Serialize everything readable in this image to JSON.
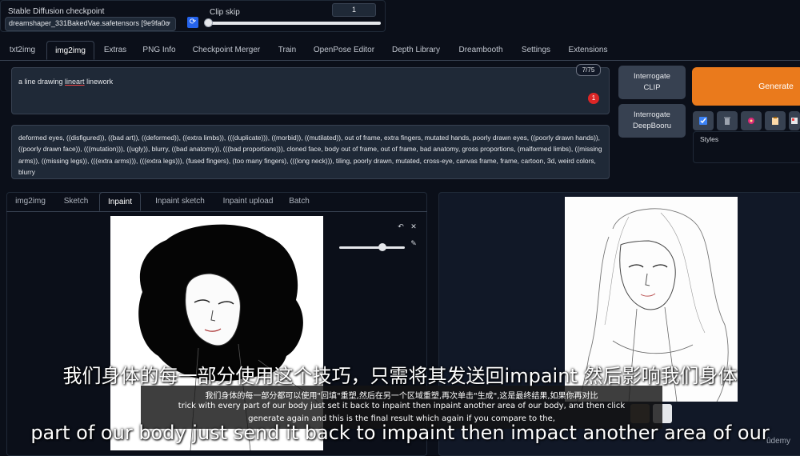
{
  "checkpoint": {
    "label": "Stable Diffusion checkpoint",
    "value": "dreamshaper_331BakedVae.safetensors [9e9fa0c"
  },
  "clip_skip": {
    "label": "Clip skip",
    "value": "1"
  },
  "main_tabs": [
    "txt2img",
    "img2img",
    "Extras",
    "PNG Info",
    "Checkpoint Merger",
    "Train",
    "OpenPose Editor",
    "Depth Library",
    "Dreambooth",
    "Settings",
    "Extensions"
  ],
  "prompt": {
    "pre": "a line drawing ",
    "underlined": "lineart",
    "post": " linework",
    "token_count": "7/75",
    "badge": "1"
  },
  "negative_prompt": "deformed eyes, ((disfigured)), ((bad art)), ((deformed)), ((extra limbs)), (((duplicate))), ((morbid)), ((mutilated)), out of frame, extra fingers, mutated hands, poorly drawn eyes, ((poorly drawn hands)), ((poorly drawn face)), (((mutation))), ((ugly)), blurry, ((bad anatomy)), (((bad proportions))), cloned face, body out of frame, out of frame, bad anatomy, gross proportions, (malformed limbs), ((missing arms)), ((missing legs)), (((extra arms))), (((extra legs))), (fused fingers), (too many fingers), (((long neck))), tiling, poorly drawn, mutated, cross-eye, canvas frame, frame, cartoon, 3d, weird colors, blurry",
  "buttons": {
    "interrogate_clip": "Interrogate CLIP",
    "interrogate_deepbooru": "Interrogate DeepBooru",
    "generate": "Generate",
    "styles_label": "Styles"
  },
  "sub_tabs": [
    "img2img",
    "Sketch",
    "Inpaint",
    "Inpaint sketch",
    "Inpaint upload",
    "Batch"
  ],
  "subtitles": {
    "cn_big": "我们身体的每一部分使用这个技巧，只需将其发送回impaint 然后影响我们身体",
    "cn_small": "我们身体的每一部分都可以使用\"回填\"重塑,然后在另一个区域重塑,再次单击\"生成\",这是最终结果,如果你再对比",
    "en_small_1": "trick with every part of our body just set it back to inpaint then inpaint another area of our body, and then click",
    "en_small_2": "generate again and this is the final result which again if you compare to the,",
    "en_big": "part of our body just send it back to impaint then impact another area of our"
  },
  "watermark": "ûdemy",
  "colors": {
    "background": "#0b0f19",
    "panel": "#1f2937",
    "generate": "#ea7a1c",
    "refresh": "#2563eb",
    "badge": "#dc2626"
  },
  "icons": [
    "refresh-icon",
    "chevron-down-icon",
    "undo-icon",
    "close-icon",
    "brush-icon",
    "paste-icon",
    "trash-icon",
    "style-apply-icon",
    "clipboard-icon",
    "save-style-icon"
  ]
}
